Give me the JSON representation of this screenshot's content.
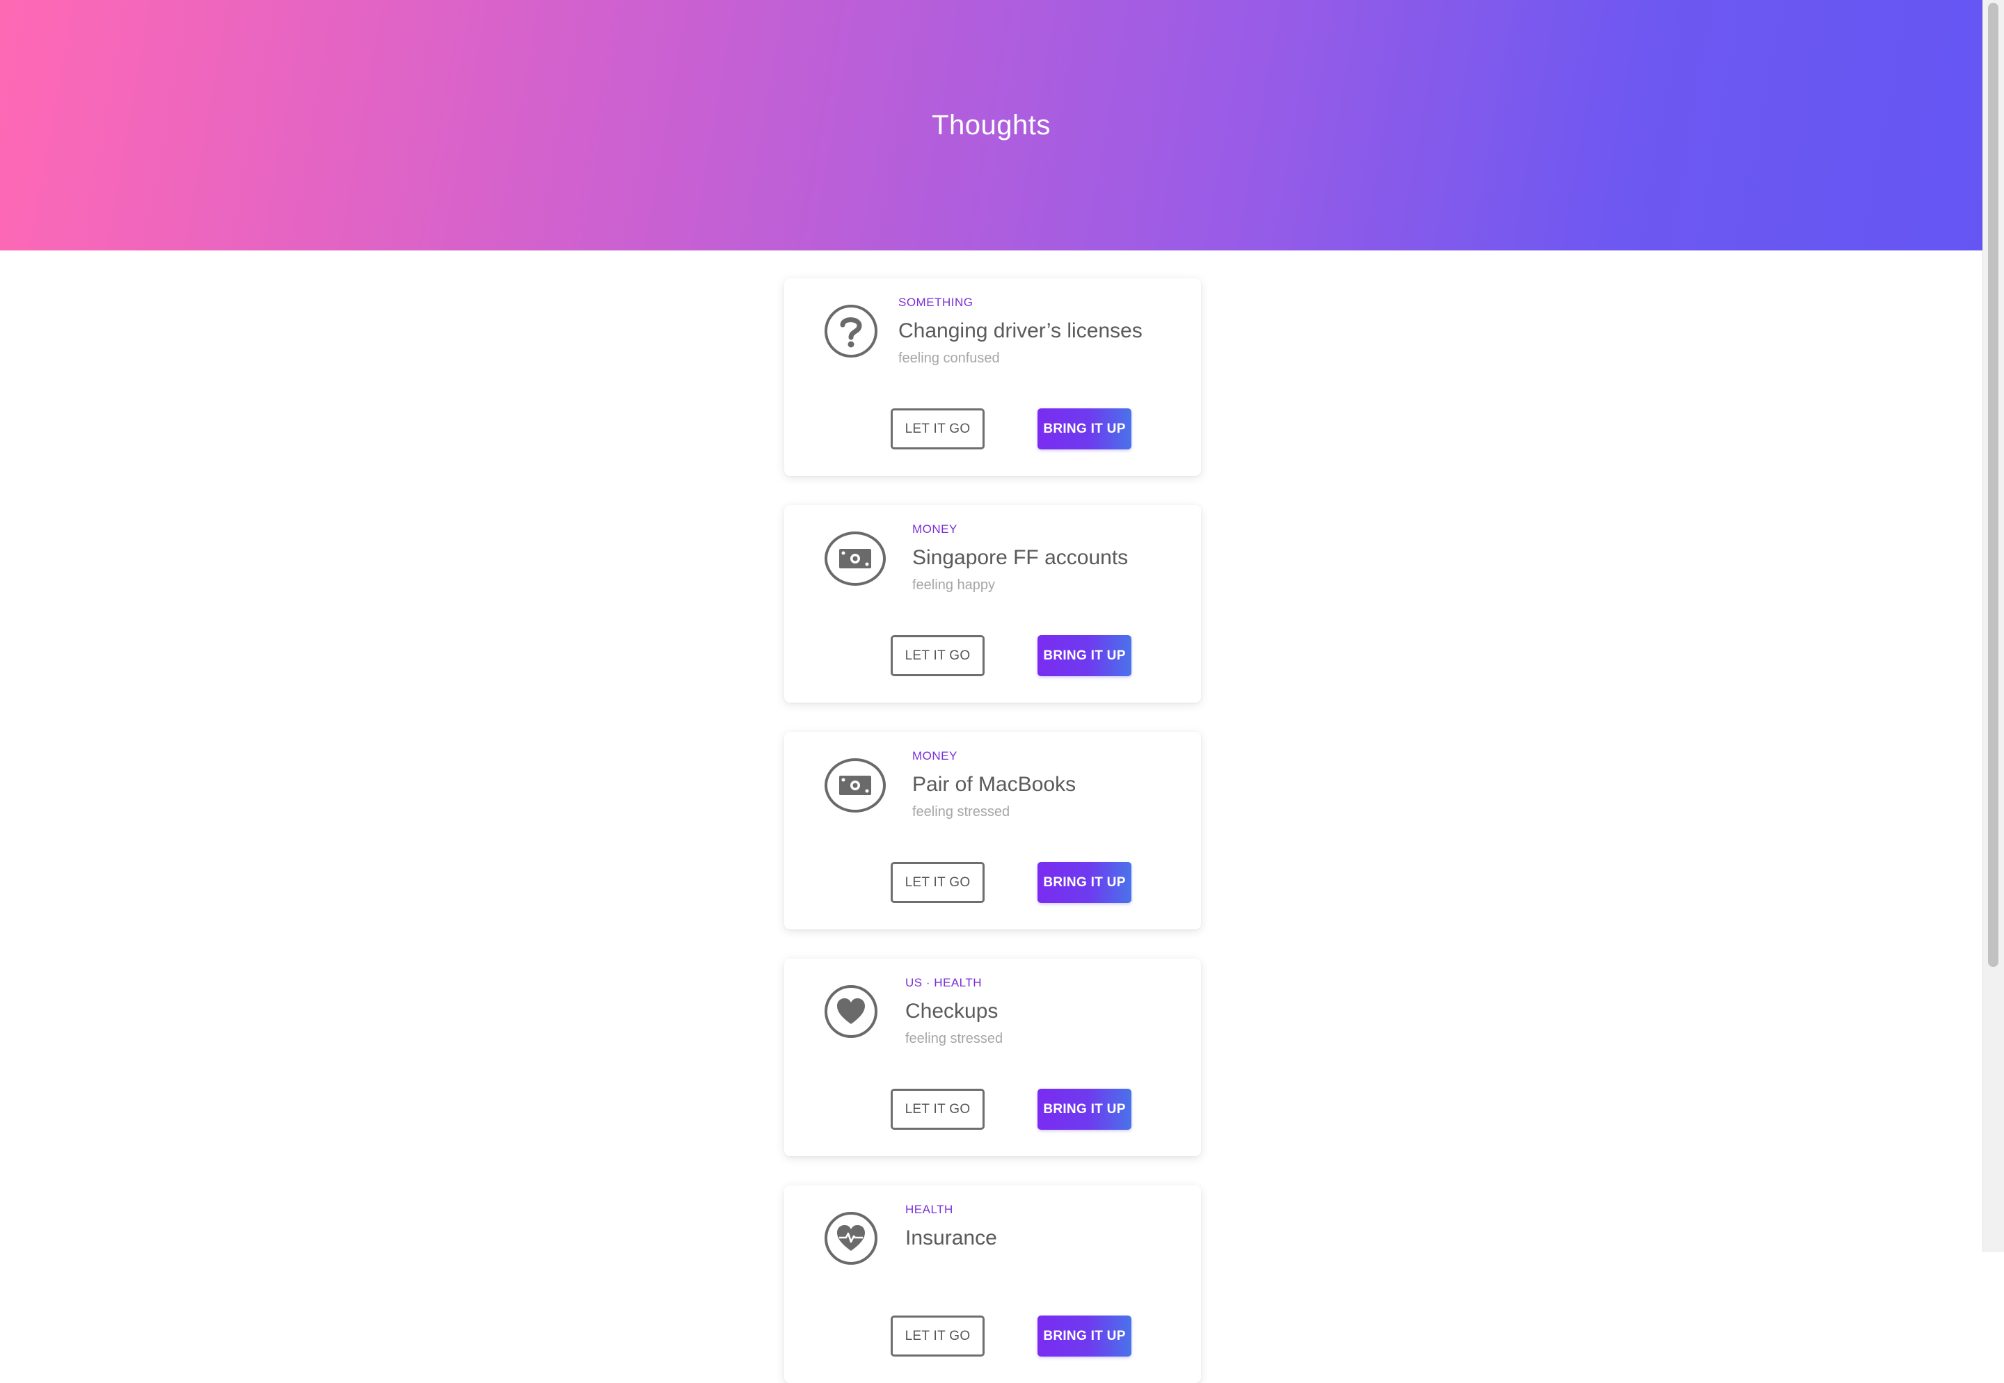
{
  "header": {
    "title": "Thoughts"
  },
  "cards": [
    {
      "category": "SOMETHING",
      "title": "Changing driver’s licenses",
      "feeling": "feeling confused",
      "icon": "question-icon",
      "let_label": "LET IT GO",
      "bring_label": "BRING IT UP"
    },
    {
      "category": "MONEY",
      "title": "Singapore FF accounts",
      "feeling": "feeling happy",
      "icon": "money-icon",
      "let_label": "LET IT GO",
      "bring_label": "BRING IT UP"
    },
    {
      "category": "MONEY",
      "title": "Pair of MacBooks",
      "feeling": "feeling stressed",
      "icon": "money-icon",
      "let_label": "LET IT GO",
      "bring_label": "BRING IT UP"
    },
    {
      "category": "US · HEALTH",
      "title": "Checkups",
      "feeling": "feeling stressed",
      "icon": "heart-icon",
      "let_label": "LET IT GO",
      "bring_label": "BRING IT UP"
    },
    {
      "category": "HEALTH",
      "title": "Insurance",
      "feeling": "",
      "icon": "heart-pulse-icon",
      "let_label": "LET IT GO",
      "bring_label": "BRING IT UP"
    }
  ],
  "colors": {
    "accent": "#7a2ed8",
    "header_start": "#ff69b4",
    "header_end": "#6556f3"
  }
}
